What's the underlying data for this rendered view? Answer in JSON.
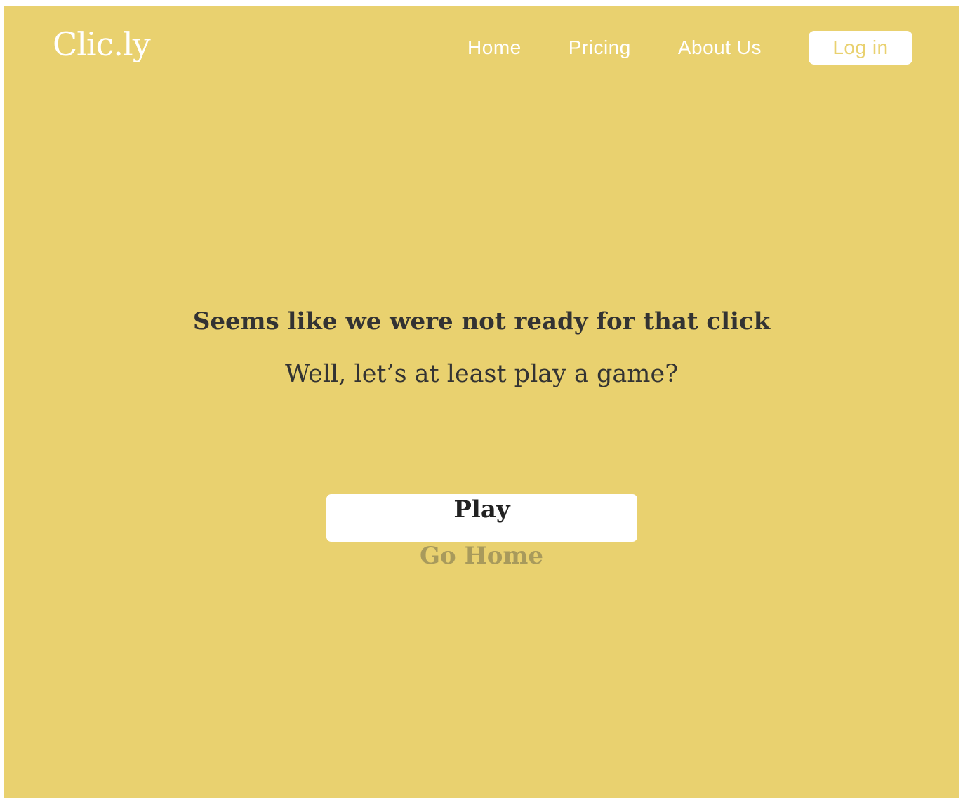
{
  "header": {
    "logo": "Clic.ly",
    "nav": {
      "home": "Home",
      "pricing": "Pricing",
      "about": "About Us"
    },
    "login_label": "Log in"
  },
  "main": {
    "headline": "Seems like we were not ready for that click",
    "subline": "Well, let’s at least play a game?",
    "play_label": "Play",
    "go_home_label": "Go Home"
  },
  "colors": {
    "background": "#e9d16f",
    "text_dark": "#333333",
    "muted_link": "#a89a5c",
    "white": "#ffffff"
  }
}
